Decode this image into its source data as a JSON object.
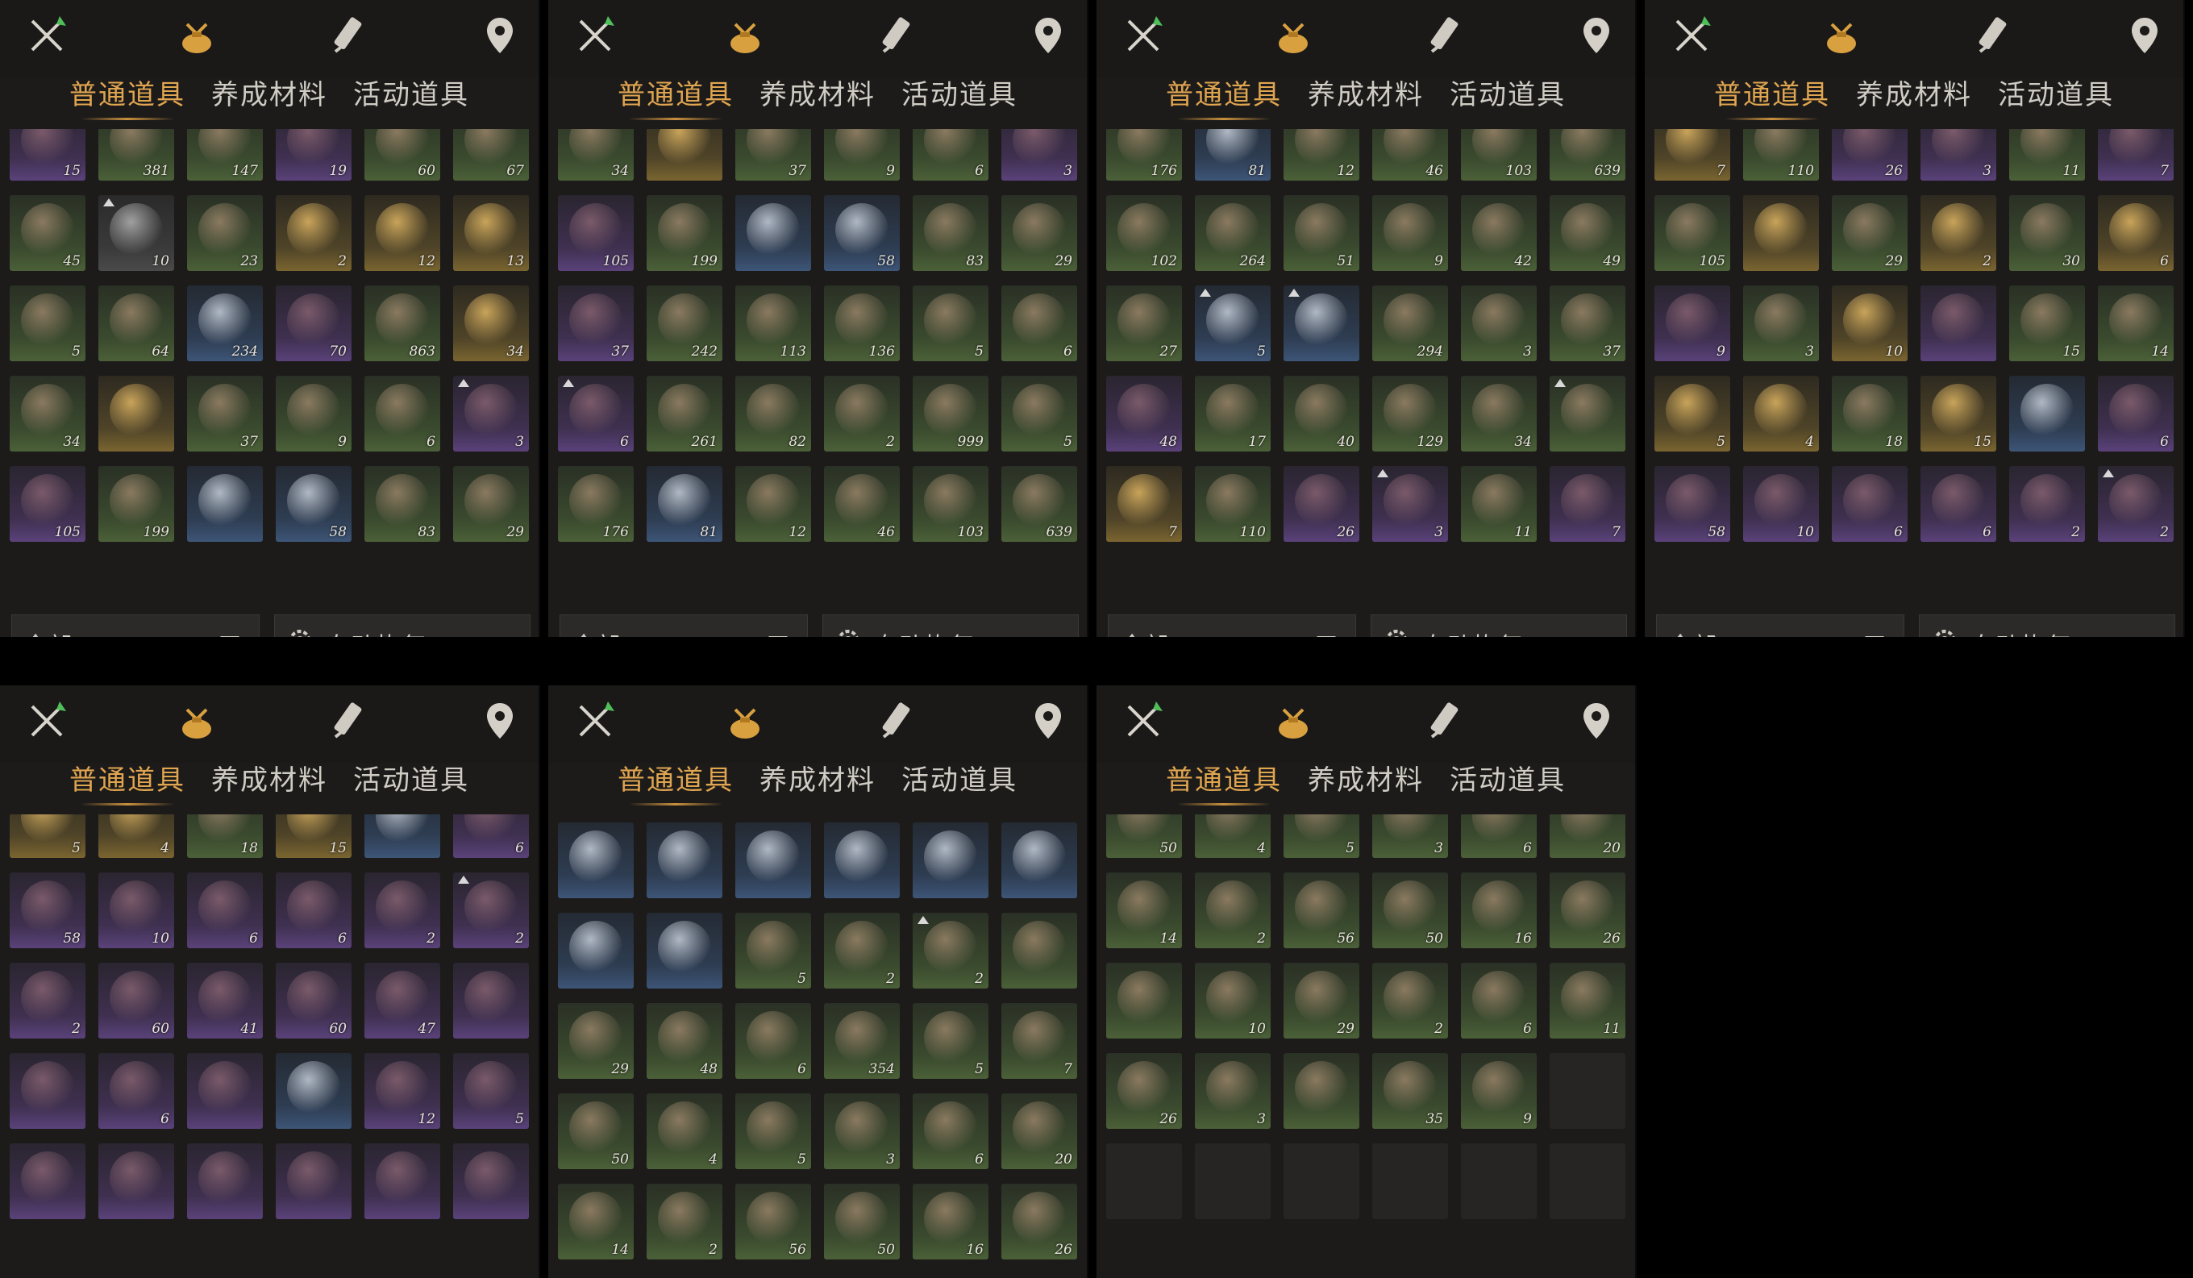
{
  "tabs": [
    "普通道具",
    "养成材料",
    "活动道具"
  ],
  "active_tab": "普通道具",
  "icons": [
    "weapons-icon",
    "item-bag-icon",
    "scroll-icon",
    "location-pin-icon"
  ],
  "filter": {
    "label": "全部"
  },
  "auto_restore": {
    "label": "自动恢复"
  },
  "colors": {
    "accent": "#e0a550",
    "panel": "#1c1b1a",
    "text": "#d4d0c8"
  },
  "panels": [
    {
      "id": "p1",
      "rows": [
        [
          {
            "q": "purple",
            "n": "15"
          },
          {
            "q": "green",
            "n": "381"
          },
          {
            "q": "green",
            "n": "147"
          },
          {
            "q": "purple",
            "n": "19",
            "up": true
          },
          {
            "q": "green",
            "n": "60"
          },
          {
            "q": "green",
            "n": "67"
          }
        ],
        [
          {
            "q": "green",
            "n": "45"
          },
          {
            "q": "white",
            "n": "10",
            "up": true
          },
          {
            "q": "green",
            "n": "23"
          },
          {
            "q": "gold",
            "n": "2"
          },
          {
            "q": "gold",
            "n": "12"
          },
          {
            "q": "gold",
            "n": "13"
          }
        ],
        [
          {
            "q": "green",
            "n": "5"
          },
          {
            "q": "green",
            "n": "64"
          },
          {
            "q": "blue",
            "n": "234"
          },
          {
            "q": "purple",
            "n": "70"
          },
          {
            "q": "green",
            "n": "863"
          },
          {
            "q": "gold",
            "n": "34"
          }
        ],
        [
          {
            "q": "green",
            "n": "34"
          },
          {
            "q": "gold",
            "n": ""
          },
          {
            "q": "green",
            "n": "37"
          },
          {
            "q": "green",
            "n": "9"
          },
          {
            "q": "green",
            "n": "6"
          },
          {
            "q": "purple",
            "n": "3",
            "up": true
          }
        ],
        [
          {
            "q": "purple",
            "n": "105"
          },
          {
            "q": "green",
            "n": "199"
          },
          {
            "q": "blue",
            "n": ""
          },
          {
            "q": "blue",
            "n": "58"
          },
          {
            "q": "green",
            "n": "83"
          },
          {
            "q": "green",
            "n": "29"
          }
        ]
      ]
    },
    {
      "id": "p2",
      "rows": [
        [
          {
            "q": "green",
            "n": "34"
          },
          {
            "q": "gold",
            "n": ""
          },
          {
            "q": "green",
            "n": "37"
          },
          {
            "q": "green",
            "n": "9"
          },
          {
            "q": "green",
            "n": "6"
          },
          {
            "q": "purple",
            "n": "3"
          }
        ],
        [
          {
            "q": "purple",
            "n": "105"
          },
          {
            "q": "green",
            "n": "199"
          },
          {
            "q": "blue",
            "n": ""
          },
          {
            "q": "blue",
            "n": "58"
          },
          {
            "q": "green",
            "n": "83"
          },
          {
            "q": "green",
            "n": "29"
          }
        ],
        [
          {
            "q": "purple",
            "n": "37"
          },
          {
            "q": "green",
            "n": "242"
          },
          {
            "q": "green",
            "n": "113"
          },
          {
            "q": "green",
            "n": "136"
          },
          {
            "q": "green",
            "n": "5"
          },
          {
            "q": "green",
            "n": "6"
          }
        ],
        [
          {
            "q": "purple",
            "n": "6",
            "up": true
          },
          {
            "q": "green",
            "n": "261"
          },
          {
            "q": "green",
            "n": "82"
          },
          {
            "q": "green",
            "n": "2"
          },
          {
            "q": "green",
            "n": "999"
          },
          {
            "q": "green",
            "n": "5"
          }
        ],
        [
          {
            "q": "green",
            "n": "176"
          },
          {
            "q": "blue",
            "n": "81"
          },
          {
            "q": "green",
            "n": "12"
          },
          {
            "q": "green",
            "n": "46"
          },
          {
            "q": "green",
            "n": "103"
          },
          {
            "q": "green",
            "n": "639"
          }
        ]
      ]
    },
    {
      "id": "p3",
      "rows": [
        [
          {
            "q": "green",
            "n": "176"
          },
          {
            "q": "blue",
            "n": "81"
          },
          {
            "q": "green",
            "n": "12"
          },
          {
            "q": "green",
            "n": "46"
          },
          {
            "q": "green",
            "n": "103"
          },
          {
            "q": "green",
            "n": "639"
          }
        ],
        [
          {
            "q": "green",
            "n": "102"
          },
          {
            "q": "green",
            "n": "264"
          },
          {
            "q": "green",
            "n": "51"
          },
          {
            "q": "green",
            "n": "9"
          },
          {
            "q": "green",
            "n": "42"
          },
          {
            "q": "green",
            "n": "49"
          }
        ],
        [
          {
            "q": "green",
            "n": "27"
          },
          {
            "q": "blue",
            "n": "5",
            "up": true
          },
          {
            "q": "blue",
            "n": "",
            "up": true
          },
          {
            "q": "green",
            "n": "294"
          },
          {
            "q": "green",
            "n": "3"
          },
          {
            "q": "green",
            "n": "37"
          }
        ],
        [
          {
            "q": "purple",
            "n": "48"
          },
          {
            "q": "green",
            "n": "17"
          },
          {
            "q": "green",
            "n": "40"
          },
          {
            "q": "green",
            "n": "129"
          },
          {
            "q": "green",
            "n": "34"
          },
          {
            "q": "green",
            "n": "",
            "up": true
          }
        ],
        [
          {
            "q": "gold",
            "n": "7"
          },
          {
            "q": "green",
            "n": "110"
          },
          {
            "q": "purple",
            "n": "26"
          },
          {
            "q": "purple",
            "n": "3",
            "up": true
          },
          {
            "q": "green",
            "n": "11"
          },
          {
            "q": "purple",
            "n": "7"
          }
        ]
      ]
    },
    {
      "id": "p4",
      "rows": [
        [
          {
            "q": "gold",
            "n": "7"
          },
          {
            "q": "green",
            "n": "110"
          },
          {
            "q": "purple",
            "n": "26"
          },
          {
            "q": "purple",
            "n": "3",
            "up": true
          },
          {
            "q": "green",
            "n": "11"
          },
          {
            "q": "purple",
            "n": "7"
          }
        ],
        [
          {
            "q": "green",
            "n": "105"
          },
          {
            "q": "gold",
            "n": ""
          },
          {
            "q": "green",
            "n": "29"
          },
          {
            "q": "gold",
            "n": "2"
          },
          {
            "q": "green",
            "n": "30"
          },
          {
            "q": "gold",
            "n": "6"
          }
        ],
        [
          {
            "q": "purple",
            "n": "9"
          },
          {
            "q": "green",
            "n": "3"
          },
          {
            "q": "gold",
            "n": "10"
          },
          {
            "q": "purple",
            "n": ""
          },
          {
            "q": "green",
            "n": "15"
          },
          {
            "q": "green",
            "n": "14"
          }
        ],
        [
          {
            "q": "gold",
            "n": "5"
          },
          {
            "q": "gold",
            "n": "4"
          },
          {
            "q": "green",
            "n": "18"
          },
          {
            "q": "gold",
            "n": "15"
          },
          {
            "q": "blue",
            "n": ""
          },
          {
            "q": "purple",
            "n": "6"
          }
        ],
        [
          {
            "q": "purple",
            "n": "58"
          },
          {
            "q": "purple",
            "n": "10"
          },
          {
            "q": "purple",
            "n": "6"
          },
          {
            "q": "purple",
            "n": "6"
          },
          {
            "q": "purple",
            "n": "2"
          },
          {
            "q": "purple",
            "n": "2",
            "up": true
          }
        ]
      ]
    },
    {
      "id": "p5",
      "rows": [
        [
          {
            "q": "gold",
            "n": "5"
          },
          {
            "q": "gold",
            "n": "4"
          },
          {
            "q": "green",
            "n": "18"
          },
          {
            "q": "gold",
            "n": "15"
          },
          {
            "q": "blue",
            "n": ""
          },
          {
            "q": "purple",
            "n": "6"
          }
        ],
        [
          {
            "q": "purple",
            "n": "58"
          },
          {
            "q": "purple",
            "n": "10"
          },
          {
            "q": "purple",
            "n": "6"
          },
          {
            "q": "purple",
            "n": "6"
          },
          {
            "q": "purple",
            "n": "2"
          },
          {
            "q": "purple",
            "n": "2",
            "up": true
          }
        ],
        [
          {
            "q": "purple",
            "n": "2"
          },
          {
            "q": "purple",
            "n": "60"
          },
          {
            "q": "purple",
            "n": "41"
          },
          {
            "q": "purple",
            "n": "60"
          },
          {
            "q": "purple",
            "n": "47"
          },
          {
            "q": "purple",
            "n": ""
          }
        ],
        [
          {
            "q": "purple",
            "n": ""
          },
          {
            "q": "purple",
            "n": "6"
          },
          {
            "q": "purple",
            "n": ""
          },
          {
            "q": "blue",
            "n": ""
          },
          {
            "q": "purple",
            "n": "12"
          },
          {
            "q": "purple",
            "n": "5"
          }
        ],
        [
          {
            "q": "purple",
            "n": ""
          },
          {
            "q": "purple",
            "n": ""
          },
          {
            "q": "purple",
            "n": ""
          },
          {
            "q": "purple",
            "n": ""
          },
          {
            "q": "purple",
            "n": ""
          },
          {
            "q": "purple",
            "n": ""
          }
        ]
      ]
    },
    {
      "id": "p6",
      "rows": [
        [
          {
            "q": "blue",
            "n": ""
          },
          {
            "q": "blue",
            "n": ""
          },
          {
            "q": "blue",
            "n": ""
          },
          {
            "q": "blue",
            "n": ""
          },
          {
            "q": "blue",
            "n": ""
          },
          {
            "q": "blue",
            "n": ""
          }
        ],
        [
          {
            "q": "blue",
            "n": ""
          },
          {
            "q": "blue",
            "n": ""
          },
          {
            "q": "green",
            "n": "5"
          },
          {
            "q": "green",
            "n": "2"
          },
          {
            "q": "green",
            "n": "2",
            "up": true
          },
          {
            "q": "green",
            "n": ""
          }
        ],
        [
          {
            "q": "green",
            "n": "29"
          },
          {
            "q": "green",
            "n": "48"
          },
          {
            "q": "green",
            "n": "6"
          },
          {
            "q": "green",
            "n": "354"
          },
          {
            "q": "green",
            "n": "5"
          },
          {
            "q": "green",
            "n": "7"
          }
        ],
        [
          {
            "q": "green",
            "n": "50"
          },
          {
            "q": "green",
            "n": "4"
          },
          {
            "q": "green",
            "n": "5"
          },
          {
            "q": "green",
            "n": "3"
          },
          {
            "q": "green",
            "n": "6"
          },
          {
            "q": "green",
            "n": "20"
          }
        ],
        [
          {
            "q": "green",
            "n": "14"
          },
          {
            "q": "green",
            "n": "2"
          },
          {
            "q": "green",
            "n": "56"
          },
          {
            "q": "green",
            "n": "50"
          },
          {
            "q": "green",
            "n": "16"
          },
          {
            "q": "green",
            "n": "26"
          }
        ]
      ]
    },
    {
      "id": "p7",
      "rows": [
        [
          {
            "q": "green",
            "n": "50"
          },
          {
            "q": "green",
            "n": "4"
          },
          {
            "q": "green",
            "n": "5"
          },
          {
            "q": "green",
            "n": "3"
          },
          {
            "q": "green",
            "n": "6"
          },
          {
            "q": "green",
            "n": "20"
          }
        ],
        [
          {
            "q": "green",
            "n": "14"
          },
          {
            "q": "green",
            "n": "2"
          },
          {
            "q": "green",
            "n": "56"
          },
          {
            "q": "green",
            "n": "50"
          },
          {
            "q": "green",
            "n": "16"
          },
          {
            "q": "green",
            "n": "26"
          }
        ],
        [
          {
            "q": "green",
            "n": ""
          },
          {
            "q": "green",
            "n": "10"
          },
          {
            "q": "green",
            "n": "29"
          },
          {
            "q": "green",
            "n": "2"
          },
          {
            "q": "green",
            "n": "6"
          },
          {
            "q": "green",
            "n": "11"
          }
        ],
        [
          {
            "q": "green",
            "n": "26"
          },
          {
            "q": "green",
            "n": "3"
          },
          {
            "q": "green",
            "n": ""
          },
          {
            "q": "green",
            "n": "35"
          },
          {
            "q": "green",
            "n": "9"
          },
          {
            "q": "empty",
            "n": ""
          }
        ],
        [
          {
            "q": "empty",
            "n": ""
          },
          {
            "q": "empty",
            "n": ""
          },
          {
            "q": "empty",
            "n": ""
          },
          {
            "q": "empty",
            "n": ""
          },
          {
            "q": "empty",
            "n": ""
          },
          {
            "q": "empty",
            "n": ""
          }
        ]
      ]
    }
  ]
}
